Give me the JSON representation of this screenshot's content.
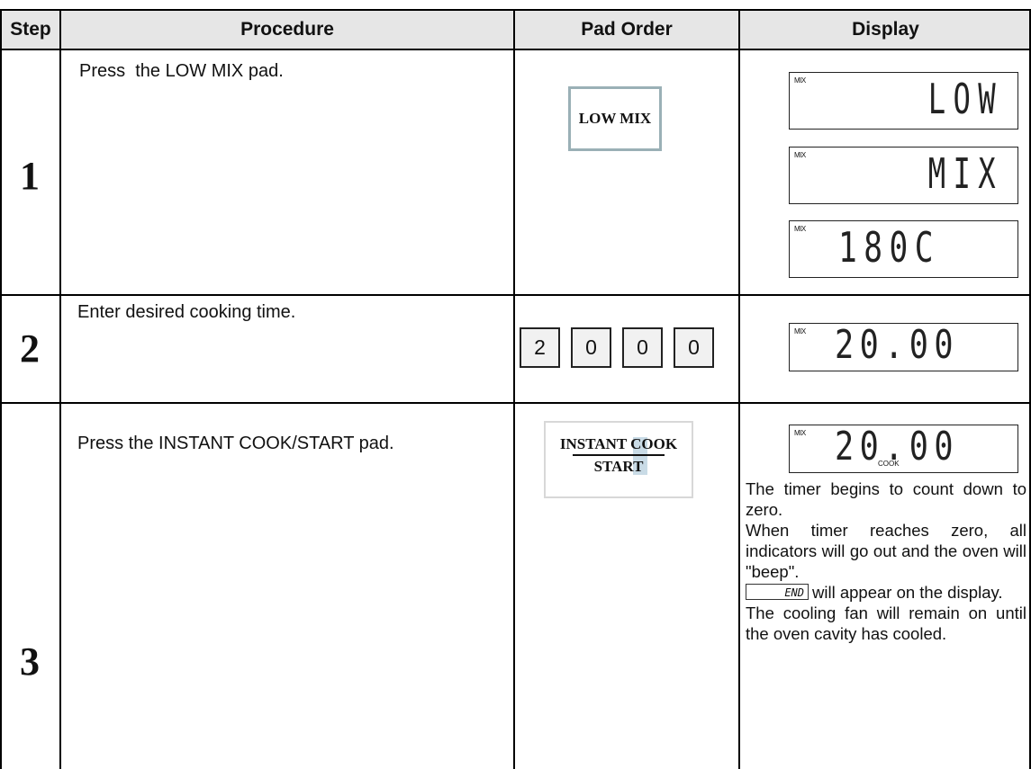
{
  "headers": {
    "step": "Step",
    "procedure": "Procedure",
    "pad_order": "Pad Order",
    "display": "Display"
  },
  "steps": [
    {
      "number": "1",
      "procedure": "Press  the LOW MIX pad.",
      "pad": "LOW MIX",
      "displays": [
        {
          "indicator": "MIX",
          "text": "LOW"
        },
        {
          "indicator": "MIX",
          "text": "MIX"
        },
        {
          "indicator": "MIX",
          "text": "180C"
        }
      ]
    },
    {
      "number": "2",
      "procedure": "Enter desired cooking time.",
      "keys": [
        "2",
        "0",
        "0",
        "0"
      ],
      "displays": [
        {
          "indicator": "MIX",
          "text": "20.00"
        }
      ]
    },
    {
      "number": "3",
      "procedure": "Press the INSTANT COOK/START pad.",
      "pad_line1": "INSTANT COOK",
      "pad_line2": "START",
      "displays": [
        {
          "indicator": "MIX",
          "text": "20.00",
          "sub": "COOK"
        }
      ],
      "notes": {
        "p1": "The timer begins to  count down to zero.",
        "p2": "When timer reaches zero, all indicators will go out and the oven will \"beep\".",
        "end_symbol": "END",
        "p3": "will appear on the display.",
        "p4": "The cooling fan will remain on until the oven cavity has cooled."
      }
    }
  ]
}
